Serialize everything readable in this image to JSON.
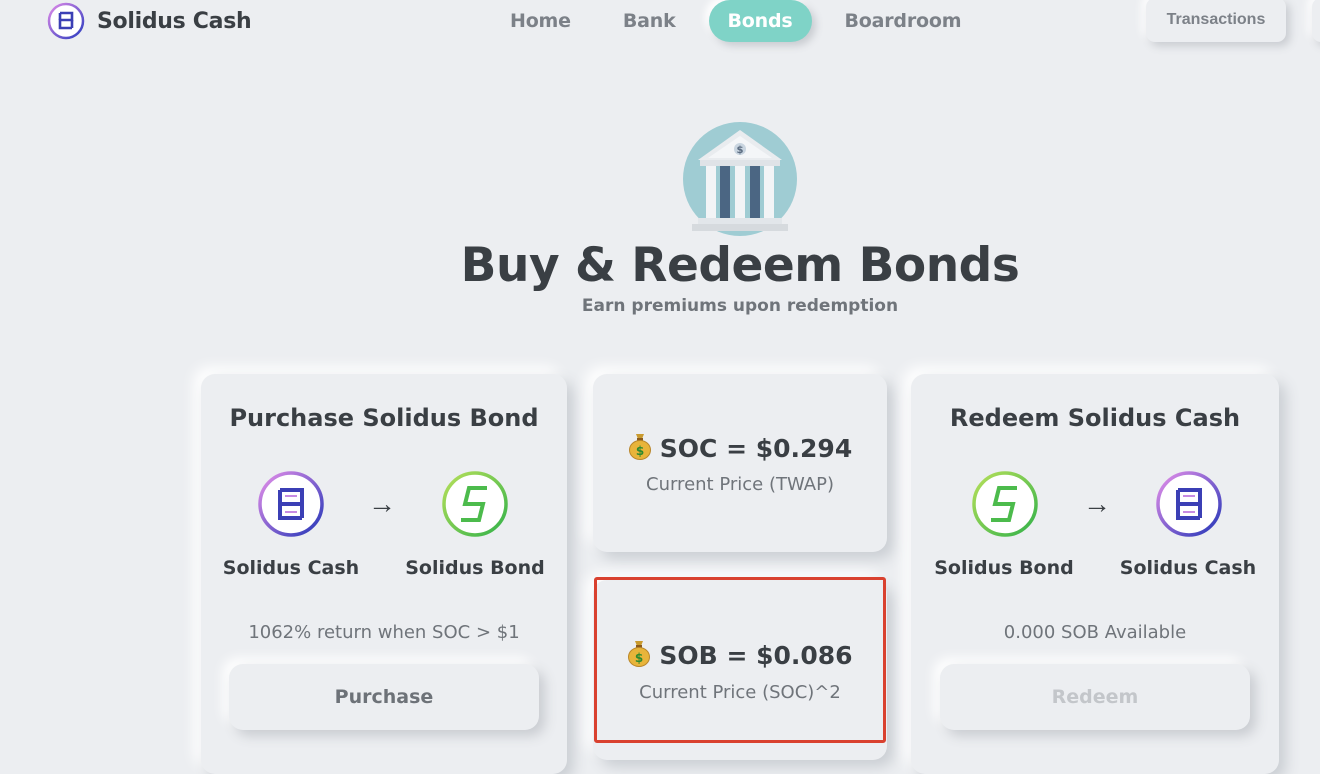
{
  "brand": {
    "name": "Solidus Cash"
  },
  "nav": {
    "items": [
      {
        "label": "Home",
        "active": false
      },
      {
        "label": "Bank",
        "active": false
      },
      {
        "label": "Bonds",
        "active": true
      },
      {
        "label": "Boardroom",
        "active": false
      }
    ],
    "transactions_label": "Transactions"
  },
  "hero": {
    "title": "Buy & Redeem Bonds",
    "subtitle": "Earn premiums upon redemption",
    "icon": "bank-building-icon"
  },
  "purchase_card": {
    "title": "Purchase Solidus Bond",
    "from_token": "Solidus Cash",
    "to_token": "Solidus Bond",
    "arrow": "→",
    "info": "1062% return when SOC > $1",
    "button_label": "Purchase"
  },
  "soc_price": {
    "value": "SOC = $0.294",
    "label": "Current Price (TWAP)"
  },
  "sob_price": {
    "value": "SOB = $0.086",
    "label": "Current Price (SOC)^2"
  },
  "redeem_card": {
    "title": "Redeem Solidus Cash",
    "from_token": "Solidus Bond",
    "to_token": "Solidus Cash",
    "arrow": "→",
    "info": "0.000 SOB Available",
    "button_label": "Redeem",
    "button_disabled": true
  },
  "colors": {
    "background": "#eceef1",
    "accent": "#7fd3c7",
    "text": "#3a3f44",
    "muted": "#6f747a",
    "highlight": "#d9412f"
  }
}
